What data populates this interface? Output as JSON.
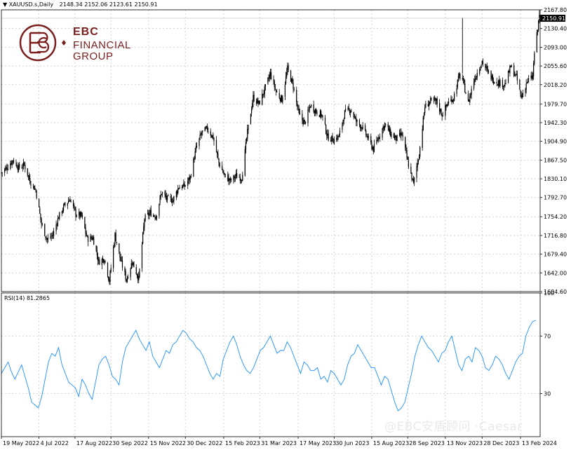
{
  "header": {
    "symbol": "XAUUSD.s,Daily",
    "ohlc": "2148.34 2152.06 2123.61 2150.91"
  },
  "rsi_header": "RSI(14) 81.2865",
  "logo": {
    "line1": "EBC",
    "line2": "FINANCIAL",
    "line3": "GROUP"
  },
  "watermark": "@EBC安盾顾问 ·Caesar",
  "colors": {
    "candle": "#000000",
    "grid": "#c8c8c8",
    "rsi_line": "#1e90ff",
    "brand": "#7a1d1d",
    "price_tag": "#000000"
  },
  "chart_data": [
    {
      "type": "candlestick",
      "symbol": "XAUUSD.s",
      "timeframe": "Daily",
      "current_price_label": "2150.91",
      "y_ticks": [
        "2167.80",
        "2130.40",
        "2093.00",
        "2055.60",
        "2018.20",
        "1979.70",
        "1942.30",
        "1904.90",
        "1867.50",
        "1830.10",
        "1792.70",
        "1754.20",
        "1716.80",
        "1679.40",
        "1642.00",
        "1604.60"
      ],
      "x_ticks": [
        "19 May 2022",
        "4 Jul 2022",
        "17 Aug 2022",
        "30 Sep 2022",
        "15 Nov 2022",
        "30 Dec 2022",
        "15 Feb 2023",
        "31 Mar 2023",
        "17 May 2023",
        "30 Jun 2023",
        "15 Aug 2023",
        "28 Sep 2023",
        "13 Nov 2023",
        "28 Dec 2023",
        "13 Feb 2024"
      ],
      "ylim": [
        1604.6,
        2167.8
      ],
      "grid": true,
      "close_path": [
        [
          "2022-05-19",
          1842
        ],
        [
          "2022-05-26",
          1853
        ],
        [
          "2022-06-02",
          1868
        ],
        [
          "2022-06-09",
          1852
        ],
        [
          "2022-06-16",
          1858
        ],
        [
          "2022-06-23",
          1826
        ],
        [
          "2022-06-30",
          1807
        ],
        [
          "2022-07-07",
          1740
        ],
        [
          "2022-07-14",
          1708
        ],
        [
          "2022-07-21",
          1718
        ],
        [
          "2022-07-28",
          1754
        ],
        [
          "2022-08-04",
          1776
        ],
        [
          "2022-08-11",
          1790
        ],
        [
          "2022-08-18",
          1760
        ],
        [
          "2022-08-25",
          1756
        ],
        [
          "2022-09-01",
          1710
        ],
        [
          "2022-09-08",
          1712
        ],
        [
          "2022-09-15",
          1664
        ],
        [
          "2022-09-22",
          1671
        ],
        [
          "2022-09-28",
          1626
        ],
        [
          "2022-10-05",
          1718
        ],
        [
          "2022-10-12",
          1666
        ],
        [
          "2022-10-19",
          1628
        ],
        [
          "2022-10-26",
          1665
        ],
        [
          "2022-11-03",
          1630
        ],
        [
          "2022-11-10",
          1750
        ],
        [
          "2022-11-17",
          1762
        ],
        [
          "2022-11-24",
          1755
        ],
        [
          "2022-12-01",
          1803
        ],
        [
          "2022-12-08",
          1789
        ],
        [
          "2022-12-15",
          1788
        ],
        [
          "2022-12-22",
          1814
        ],
        [
          "2022-12-29",
          1815
        ],
        [
          "2023-01-05",
          1833
        ],
        [
          "2023-01-12",
          1890
        ],
        [
          "2023-01-19",
          1922
        ],
        [
          "2023-01-26",
          1930
        ],
        [
          "2023-02-02",
          1913
        ],
        [
          "2023-02-09",
          1862
        ],
        [
          "2023-02-16",
          1836
        ],
        [
          "2023-02-23",
          1826
        ],
        [
          "2023-03-02",
          1836
        ],
        [
          "2023-03-09",
          1832
        ],
        [
          "2023-03-16",
          1923
        ],
        [
          "2023-03-23",
          1993
        ],
        [
          "2023-03-30",
          1980
        ],
        [
          "2023-04-06",
          2008
        ],
        [
          "2023-04-13",
          2040
        ],
        [
          "2023-04-20",
          2004
        ],
        [
          "2023-04-27",
          1988
        ],
        [
          "2023-05-04",
          2050
        ],
        [
          "2023-05-11",
          2015
        ],
        [
          "2023-05-18",
          1958
        ],
        [
          "2023-05-25",
          1941
        ],
        [
          "2023-06-01",
          1977
        ],
        [
          "2023-06-08",
          1965
        ],
        [
          "2023-06-15",
          1957
        ],
        [
          "2023-06-22",
          1914
        ],
        [
          "2023-06-29",
          1908
        ],
        [
          "2023-07-06",
          1915
        ],
        [
          "2023-07-13",
          1962
        ],
        [
          "2023-07-20",
          1969
        ],
        [
          "2023-07-27",
          1945
        ],
        [
          "2023-08-03",
          1934
        ],
        [
          "2023-08-10",
          1912
        ],
        [
          "2023-08-17",
          1889
        ],
        [
          "2023-08-24",
          1916
        ],
        [
          "2023-08-31",
          1940
        ],
        [
          "2023-09-07",
          1920
        ],
        [
          "2023-09-14",
          1910
        ],
        [
          "2023-09-21",
          1919
        ],
        [
          "2023-09-28",
          1864
        ],
        [
          "2023-10-05",
          1820
        ],
        [
          "2023-10-12",
          1880
        ],
        [
          "2023-10-19",
          1974
        ],
        [
          "2023-10-26",
          1985
        ],
        [
          "2023-11-02",
          1985
        ],
        [
          "2023-11-09",
          1958
        ],
        [
          "2023-11-16",
          1981
        ],
        [
          "2023-11-23",
          1992
        ],
        [
          "2023-11-30",
          2036
        ],
        [
          "2023-12-04",
          2029
        ],
        [
          "2023-12-11",
          1982
        ],
        [
          "2023-12-18",
          2027
        ],
        [
          "2023-12-28",
          2065
        ],
        [
          "2024-01-04",
          2043
        ],
        [
          "2024-01-11",
          2028
        ],
        [
          "2024-01-18",
          2022
        ],
        [
          "2024-01-25",
          2019
        ],
        [
          "2024-02-01",
          2054
        ],
        [
          "2024-02-08",
          2033
        ],
        [
          "2024-02-14",
          1992
        ],
        [
          "2024-02-21",
          2025
        ],
        [
          "2024-02-28",
          2034
        ],
        [
          "2024-03-01",
          2083
        ],
        [
          "2024-03-05",
          2128
        ],
        [
          "2024-03-07",
          2160
        ]
      ]
    },
    {
      "type": "line",
      "indicator": "RSI(14)",
      "current_value": 81.2865,
      "ylim": [
        0,
        100
      ],
      "y_ticks": [
        "100",
        "70",
        "30"
      ],
      "levels": [
        70,
        30
      ],
      "values": [
        44,
        48,
        52,
        45,
        40,
        45,
        50,
        42,
        34,
        24,
        22,
        20,
        28,
        40,
        52,
        58,
        56,
        62,
        50,
        44,
        38,
        36,
        34,
        28,
        40,
        36,
        30,
        26,
        38,
        50,
        54,
        56,
        50,
        42,
        40,
        36,
        52,
        62,
        66,
        70,
        74,
        68,
        64,
        60,
        66,
        56,
        52,
        48,
        54,
        60,
        58,
        64,
        66,
        70,
        74,
        72,
        68,
        66,
        62,
        60,
        56,
        50,
        44,
        40,
        44,
        42,
        54,
        60,
        66,
        70,
        64,
        56,
        50,
        46,
        44,
        48,
        54,
        60,
        62,
        66,
        70,
        64,
        58,
        60,
        60,
        66,
        62,
        56,
        50,
        44,
        52,
        50,
        46,
        46,
        48,
        40,
        42,
        38,
        46,
        44,
        40,
        36,
        40,
        50,
        56,
        58,
        64,
        60,
        56,
        52,
        48,
        48,
        42,
        36,
        42,
        40,
        32,
        24,
        18,
        20,
        24,
        34,
        44,
        56,
        64,
        70,
        66,
        62,
        60,
        56,
        52,
        58,
        60,
        66,
        70,
        60,
        50,
        46,
        54,
        56,
        52,
        62,
        60,
        56,
        48,
        46,
        50,
        56,
        54,
        50,
        44,
        40,
        46,
        52,
        56,
        58,
        70,
        76,
        80,
        81
      ]
    }
  ]
}
